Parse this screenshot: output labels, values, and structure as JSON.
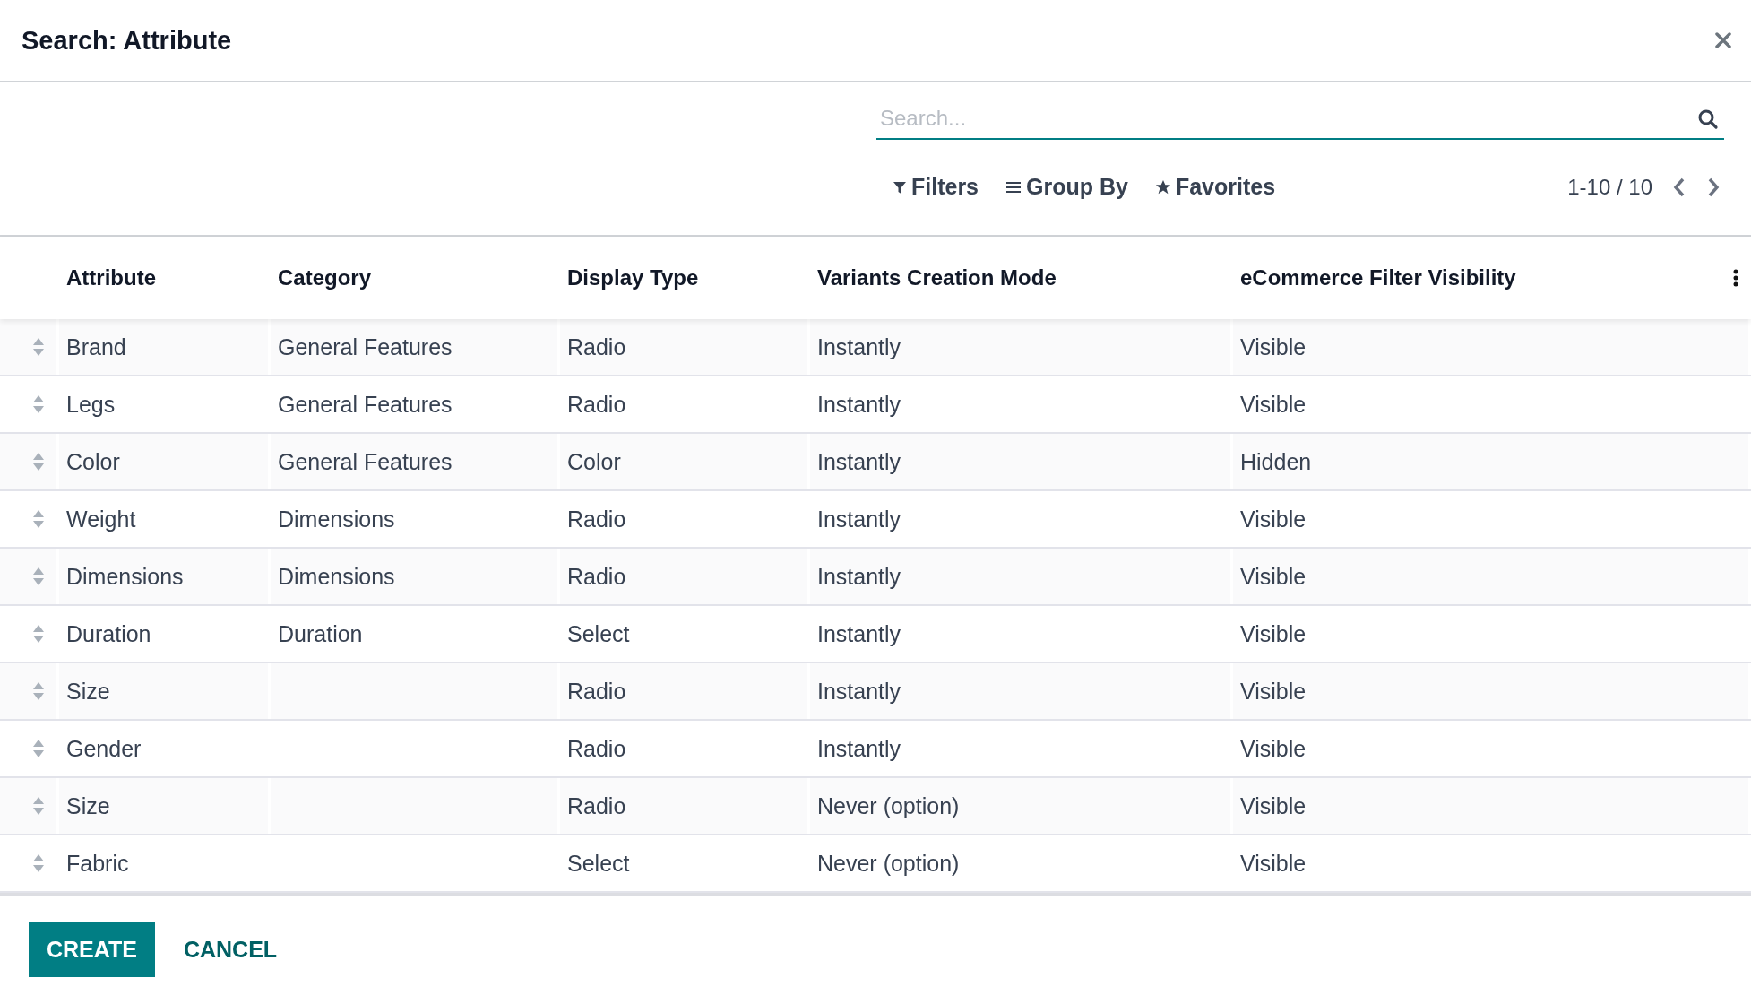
{
  "dialog": {
    "title": "Search: Attribute"
  },
  "search": {
    "placeholder": "Search..."
  },
  "toolbar": [
    "Filters",
    "Group By",
    "Favorites"
  ],
  "pager": {
    "range": "1-10 / 10"
  },
  "table": {
    "columns": [
      "Attribute",
      "Category",
      "Display Type",
      "Variants Creation Mode",
      "eCommerce Filter Visibility"
    ],
    "rows": [
      [
        "Brand",
        "General Features",
        "Radio",
        "Instantly",
        "Visible"
      ],
      [
        "Legs",
        "General Features",
        "Radio",
        "Instantly",
        "Visible"
      ],
      [
        "Color",
        "General Features",
        "Color",
        "Instantly",
        "Hidden"
      ],
      [
        "Weight",
        "Dimensions",
        "Radio",
        "Instantly",
        "Visible"
      ],
      [
        "Dimensions",
        "Dimensions",
        "Radio",
        "Instantly",
        "Visible"
      ],
      [
        "Duration",
        "Duration",
        "Select",
        "Instantly",
        "Visible"
      ],
      [
        "Size",
        "",
        "Radio",
        "Instantly",
        "Visible"
      ],
      [
        "Gender",
        "",
        "Radio",
        "Instantly",
        "Visible"
      ],
      [
        "Size",
        "",
        "Radio",
        "Never (option)",
        "Visible"
      ],
      [
        "Fabric",
        "",
        "Select",
        "Never (option)",
        "Visible"
      ]
    ]
  },
  "buttons": [
    "CREATE",
    "CANCEL"
  ]
}
